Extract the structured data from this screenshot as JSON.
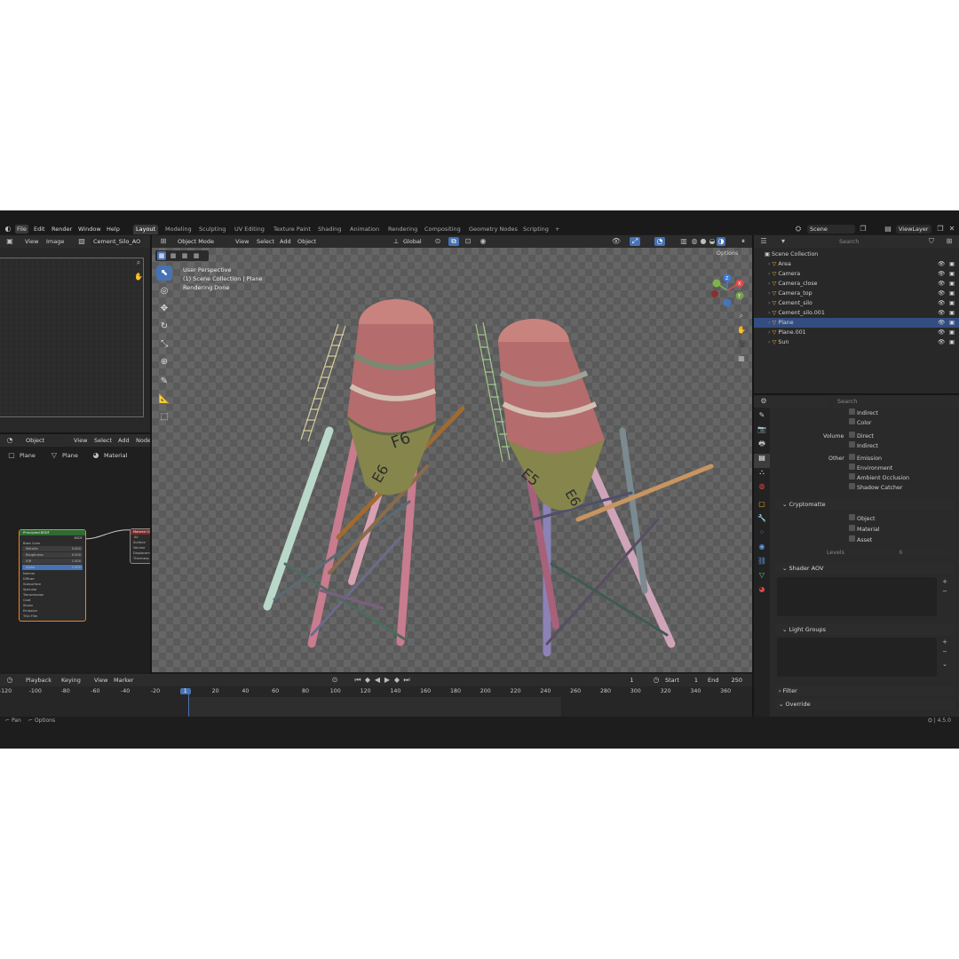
{
  "menu": [
    "File",
    "Edit",
    "Render",
    "Window",
    "Help"
  ],
  "workspaces": [
    "Layout",
    "Modeling",
    "Sculpting",
    "UV Editing",
    "Texture Paint",
    "Shading",
    "Animation",
    "Rendering",
    "Compositing",
    "Geometry Nodes",
    "Scripting",
    "+"
  ],
  "scene": {
    "name": "Scene",
    "view_layer": "ViewLayer"
  },
  "image_editor": {
    "view": "View",
    "image": "Image",
    "image_name": "Cement_Silo_AO"
  },
  "viewport": {
    "mode": "Object Mode",
    "view": "View",
    "select": "Select",
    "add": "Add",
    "object": "Object",
    "orientation": "Global",
    "options": "Options",
    "info_line1": "User Perspective",
    "info_line2": "(1) Scene Collection | Plane",
    "info_line3": "Rendering Done",
    "gizmo": {
      "x": "X",
      "y": "Y",
      "z": "Z"
    }
  },
  "node_editor": {
    "mode": "Object",
    "view": "View",
    "select": "Select",
    "add": "Add",
    "node": "Node",
    "breadcrumb": [
      "Plane",
      "Plane",
      "Material"
    ],
    "bsdf_title": "Principled BSDF",
    "bsdf_out": "BSDF",
    "bsdf_rows": [
      "Base Color",
      "Metallic",
      "Roughness",
      "IOR",
      "Alpha",
      "Normal",
      "Diffuse",
      "Subsurface",
      "Specular",
      "Transmission",
      "Coat",
      "Sheen",
      "Emission",
      "Thin Film"
    ],
    "bsdf_vals": [
      "",
      "0.000",
      "0.500",
      "1.500",
      "1.000"
    ],
    "output_title": "Material Output",
    "output_target": "All",
    "output_rows": [
      "Surface",
      "Volume",
      "Displacement",
      "Thickness"
    ]
  },
  "outliner": {
    "search": "Search",
    "root": "Scene Collection",
    "items": [
      {
        "name": "Area",
        "color": "#e8a33c"
      },
      {
        "name": "Camera",
        "color": "#e8a33c"
      },
      {
        "name": "Camera_close",
        "color": "#e8a33c"
      },
      {
        "name": "Camera_top",
        "color": "#e8a33c"
      },
      {
        "name": "Cement_silo",
        "color": "#e8a33c"
      },
      {
        "name": "Cement_silo.001",
        "color": "#e8a33c"
      },
      {
        "name": "Plane",
        "color": "#e8a33c"
      },
      {
        "name": "Plane.001",
        "color": "#e8a33c"
      },
      {
        "name": "Sun",
        "color": "#e8a33c"
      }
    ]
  },
  "properties": {
    "search": "Search",
    "indirect": "Indirect",
    "color": "Color",
    "volume": "Volume",
    "direct": "Direct",
    "indirect2": "Indirect",
    "other": "Other",
    "emission": "Emission",
    "environment": "Environment",
    "ao": "Ambient Occlusion",
    "shadow": "Shadow Catcher",
    "cryptomatte": "Cryptomatte",
    "obj": "Object",
    "mat": "Material",
    "asset": "Asset",
    "levels": "Levels",
    "levels_val": "6",
    "shader_aov": "Shader AOV",
    "light_groups": "Light Groups",
    "filter": "Filter",
    "override": "Override"
  },
  "timeline": {
    "playback": "Playback",
    "keying": "Keying",
    "view": "View",
    "marker": "Marker",
    "current": "1",
    "start_label": "Start",
    "start": "1",
    "end_label": "End",
    "end": "250",
    "ticks": [
      "-120",
      "-100",
      "-80",
      "-60",
      "-40",
      "-20",
      "1",
      "20",
      "40",
      "60",
      "80",
      "100",
      "120",
      "140",
      "160",
      "180",
      "200",
      "220",
      "240",
      "260",
      "280",
      "300",
      "320",
      "340",
      "360"
    ]
  },
  "status": {
    "pan": "Pan",
    "options": "Options",
    "version": "4.5.0"
  },
  "colors": {
    "accent": "#4772b3",
    "selection": "#334d80",
    "node_border": "#e8852a",
    "object_icon": "#e8a33c",
    "mesh_icon": "#4cd38a"
  }
}
